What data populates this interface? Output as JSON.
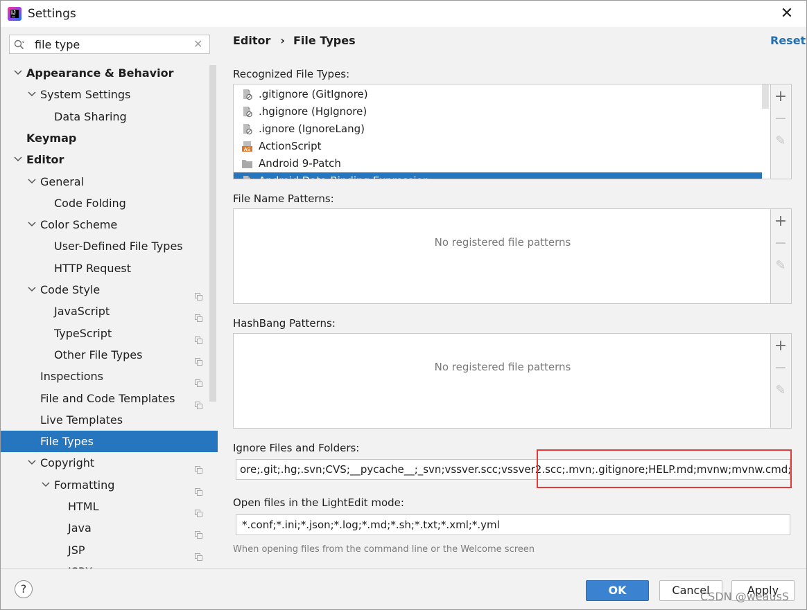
{
  "window": {
    "title": "Settings",
    "app_logo_text": "IJ",
    "close_glyph": "✕"
  },
  "search": {
    "value": "file type",
    "clear_glyph": "✕"
  },
  "sidebar": {
    "items": [
      {
        "label": "Appearance & Behavior",
        "bold": true,
        "level": 0,
        "arrow": "down",
        "copy_icon": false
      },
      {
        "label": "System Settings",
        "bold": false,
        "level": 1,
        "arrow": "down",
        "copy_icon": false
      },
      {
        "label": "Data Sharing",
        "bold": false,
        "level": 2,
        "arrow": "",
        "copy_icon": false
      },
      {
        "label": "Keymap",
        "bold": true,
        "level": 0,
        "arrow": "",
        "copy_icon": false
      },
      {
        "label": "Editor",
        "bold": true,
        "level": 0,
        "arrow": "down",
        "copy_icon": false
      },
      {
        "label": "General",
        "bold": false,
        "level": 1,
        "arrow": "down",
        "copy_icon": false
      },
      {
        "label": "Code Folding",
        "bold": false,
        "level": 2,
        "arrow": "",
        "copy_icon": false
      },
      {
        "label": "Color Scheme",
        "bold": false,
        "level": 1,
        "arrow": "down",
        "copy_icon": false
      },
      {
        "label": "User-Defined File Types",
        "bold": false,
        "level": 2,
        "arrow": "",
        "copy_icon": false
      },
      {
        "label": "HTTP Request",
        "bold": false,
        "level": 2,
        "arrow": "",
        "copy_icon": false
      },
      {
        "label": "Code Style",
        "bold": false,
        "level": 1,
        "arrow": "down",
        "copy_icon": true
      },
      {
        "label": "JavaScript",
        "bold": false,
        "level": 2,
        "arrow": "",
        "copy_icon": true
      },
      {
        "label": "TypeScript",
        "bold": false,
        "level": 2,
        "arrow": "",
        "copy_icon": true
      },
      {
        "label": "Other File Types",
        "bold": false,
        "level": 2,
        "arrow": "",
        "copy_icon": true
      },
      {
        "label": "Inspections",
        "bold": false,
        "level": 1,
        "arrow": "",
        "copy_icon": true
      },
      {
        "label": "File and Code Templates",
        "bold": false,
        "level": 1,
        "arrow": "",
        "copy_icon": true
      },
      {
        "label": "Live Templates",
        "bold": false,
        "level": 1,
        "arrow": "",
        "copy_icon": false
      },
      {
        "label": "File Types",
        "bold": false,
        "level": 1,
        "arrow": "",
        "copy_icon": false,
        "selected": true
      },
      {
        "label": "Copyright",
        "bold": false,
        "level": 1,
        "arrow": "down",
        "copy_icon": true
      },
      {
        "label": "Formatting",
        "bold": false,
        "level": 2,
        "arrow": "down",
        "copy_icon": true
      },
      {
        "label": "HTML",
        "bold": false,
        "level": 3,
        "arrow": "",
        "copy_icon": true
      },
      {
        "label": "Java",
        "bold": false,
        "level": 3,
        "arrow": "",
        "copy_icon": true
      },
      {
        "label": "JSP",
        "bold": false,
        "level": 3,
        "arrow": "",
        "copy_icon": true
      },
      {
        "label": "JSPX",
        "bold": false,
        "level": 3,
        "arrow": "",
        "copy_icon": true
      }
    ]
  },
  "breadcrumb": {
    "parent": "Editor",
    "separator": "›",
    "current": "File Types",
    "reset_label": "Reset"
  },
  "recognized": {
    "label": "Recognized File Types:",
    "items": [
      {
        "text": ".gitignore (GitIgnore)",
        "icon": "ignore-file-icon"
      },
      {
        "text": ".hgignore (HgIgnore)",
        "icon": "ignore-file-icon"
      },
      {
        "text": ".ignore (IgnoreLang)",
        "icon": "ignore-file-icon"
      },
      {
        "text": "ActionScript",
        "icon": "actionscript-icon"
      },
      {
        "text": "Android 9-Patch",
        "icon": "folder-icon"
      },
      {
        "text": "Android Data Binding Expression",
        "icon": "ignore-file-icon",
        "selected": true
      }
    ],
    "actionscript_badge": "AS"
  },
  "tools": {
    "add": "+",
    "remove": "−",
    "edit": "✎"
  },
  "file_name_patterns": {
    "label": "File Name Patterns:",
    "empty_text": "No registered file patterns"
  },
  "hashbang_patterns": {
    "label": "HashBang Patterns:",
    "empty_text": "No registered file patterns"
  },
  "ignore_files": {
    "label": "Ignore Files and Folders:",
    "value": "ore;.git;.hg;.svn;CVS;__pycache__;_svn;vssver.scc;vssver2.scc;.mvn;.gitignore;HELP.md;mvnw;mvnw.cmd;*.iml;"
  },
  "lightedit": {
    "label": "Open files in the LightEdit mode:",
    "value": "*.conf;*.ini;*.json;*.log;*.md;*.sh;*.txt;*.xml;*.yml",
    "hint": "When opening files from the command line or the Welcome screen"
  },
  "footer": {
    "help": "?",
    "ok": "OK",
    "cancel": "Cancel",
    "apply": "Apply",
    "watermark": "CSDN @weausS"
  },
  "colors": {
    "selection": "#2675bf",
    "link": "#2470b3",
    "highlight_box": "#e23a3a",
    "ok_button": "#3b83d1"
  }
}
